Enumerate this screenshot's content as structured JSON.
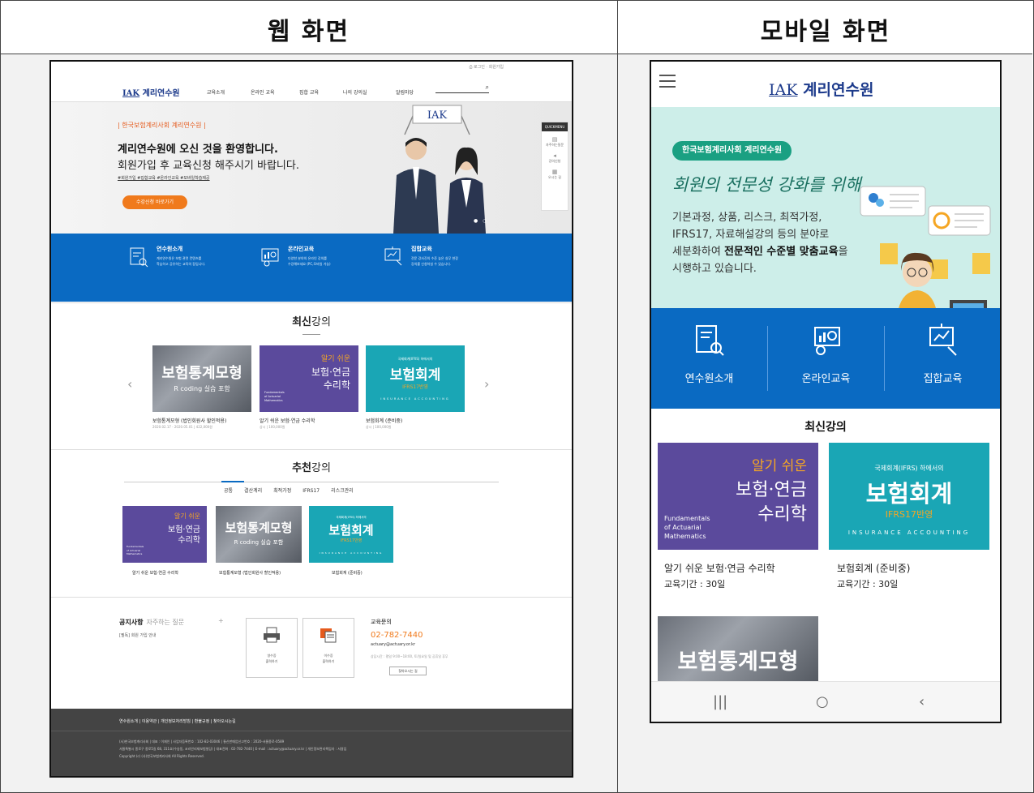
{
  "headers": {
    "web": "웹 화면",
    "mobile": "모바일 화면"
  },
  "web": {
    "util": "⎙ 로그인 · 회원가입",
    "logo_mark": "IAK",
    "logo_text": "계리연수원",
    "menu": [
      "교육소개",
      "온라인 교육",
      "집합 교육",
      "나의 강의실",
      "알림마당"
    ],
    "hero": {
      "subtitle": "| 한국보험계리사회 계리연수원 |",
      "headline1": "계리연수원에 오신 것을 환영합니다.",
      "headline2": "회원가입 후 교육신청 해주시기 바랍니다.",
      "tags": "#회원가입 #집합교육 #온라인교육 #모바일학습제공",
      "button": "수강신청 바로가기",
      "sign": "IAK",
      "dots": "● ○"
    },
    "quickmenu": {
      "title": "QUICKMENU",
      "items": [
        "자주하는질문",
        "강의신청",
        "오시는 길"
      ]
    },
    "features": [
      {
        "title": "연수원소개",
        "desc1": "계리연수원은 보험 관련 컨텐츠를",
        "desc2": "학습하고 공유하는 교육의 장입니다."
      },
      {
        "title": "온라인교육",
        "desc1": "다양한 분야의 온라인 강의를",
        "desc2": "수강해보세요 (PC,모바일 가능)"
      },
      {
        "title": "집합교육",
        "desc1": "전문 강사진의 수준 높은 실무 현장",
        "desc2": "강의를 신청하실 수 있습니다."
      }
    ],
    "latest": {
      "title_bold": "최신",
      "title_rest": "강의",
      "arrow_left": "‹",
      "arrow_right": "›",
      "cards": [
        {
          "name": "보험통계모형 (법인회원사 할인적용)",
          "meta": "2020.02.17 - 2020.05.01 | 422,000원"
        },
        {
          "name": "알기 쉬운 보험·연금 수리학",
          "meta": "상시 | 100,000원"
        },
        {
          "name": "보험회계 (준비중)",
          "meta": "상시 | 100,000원"
        }
      ]
    },
    "recommend": {
      "title_bold": "추천",
      "title_rest": "강의",
      "tabs": [
        "공통",
        "결산계리",
        "최적가정",
        "IFRS17",
        "리스크관리"
      ],
      "cards": [
        "알기 쉬운 보험·연금 수리학",
        "보험통계모형 (법인회원사 할인적용)",
        "보험회계 (준비중)"
      ]
    },
    "covers": {
      "hs_title": "보험통계모형",
      "hs_sub": "R coding 실습 포함",
      "math_top": "알기 쉬운",
      "math_mid": "보험·연금",
      "math_bot": "수리학",
      "math_en1": "Fundamentals",
      "math_en2": "of Actuarial",
      "math_en3": "Mathematics",
      "acc_top": "국제회계(IFRS) 하에서의",
      "acc_title": "보험회계",
      "acc_sub": "IFRS17반영",
      "acc_en": "INSURANCE ACCOUNTING"
    },
    "notice": {
      "title": "공지사항",
      "tab2": "자주하는 질문",
      "plus": "+",
      "item": "[필독] 회원 가입 안내"
    },
    "boxes": [
      {
        "l1": "영수증",
        "l2": "출력하기"
      },
      {
        "l1": "이수증",
        "l2": "출력하기"
      }
    ],
    "contact": {
      "title": "교육문의",
      "phone": "02-782-7440",
      "email": "actuary@actuary.or.kr",
      "hours": "상담시간 : 평일 9:00~18:00, 토/일요일 및 공휴일 휴무",
      "button": "찾아오시는 길"
    },
    "footer": {
      "links": "연수원소개  |  이용약관  |  개인정보처리방침  |  환불규정  |  찾아오시는길",
      "line1": "(사)한국보험계리사회 | 대표 : 이재인 | 사업자등록번호 : 102-82-03046 | 통신판매업신고번호 : 2020-서울종로-0589",
      "line2": "서울특별시 종로구 종로5길 68, 311호(수송동, 코리안리재보험빌딩) | 대표전화 : 02-782-7440 | E-mail : actuary@actuary.or.kr | 개인정보관리책임자 : 서영임",
      "line3": "Copyright (c) (사)한국보험계리사회 All Rights Reserved."
    }
  },
  "mobile": {
    "logo_mark": "IAK",
    "logo_text": "계리연수원",
    "hero": {
      "pill": "한국보험계리사회 계리연수원",
      "handwriting": "회원의 전문성 강화를 위해",
      "body1": "기본과정, 상품, 리스크, 최적가정,",
      "body2": "IFRS17, 자료해설강의 등의 분야로",
      "body3_pre": "세분화하여 ",
      "body3_bold": "전문적인 수준별 맞춤교육",
      "body3_post": "을",
      "body4": "시행하고 있습니다.",
      "dots": "● ○"
    },
    "features": [
      "연수원소개",
      "온라인교육",
      "집합교육"
    ],
    "latest_title": "최신강의",
    "cards": [
      {
        "name": "알기 쉬운 보험·연금 수리학",
        "period": "교육기간 : 30일"
      },
      {
        "name": "보험회계 (준비중)",
        "period": "교육기간 : 30일"
      }
    ],
    "nav": [
      "|||",
      "○",
      "‹"
    ]
  }
}
